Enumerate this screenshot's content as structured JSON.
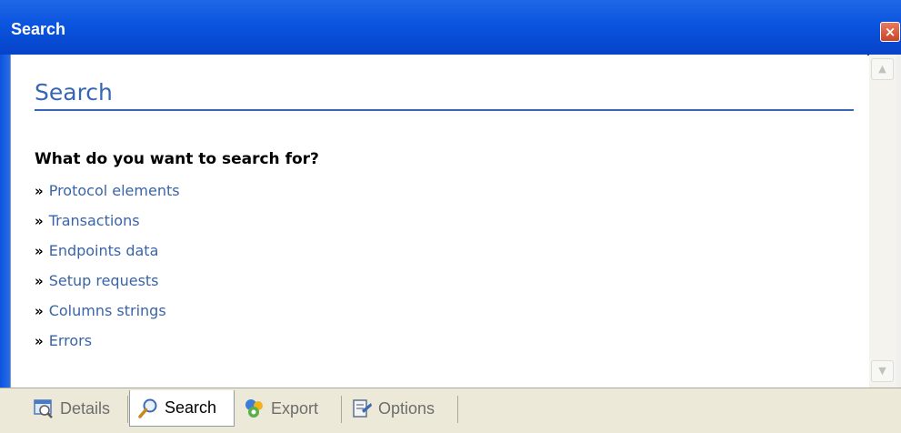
{
  "window": {
    "title": "Search",
    "close_icon": "close-icon",
    "colors": {
      "titlebar": "#0a54df",
      "heading": "#3766b3",
      "link": "#3a64a8",
      "close_button": "#c8452a",
      "tabbar": "#ece9d8"
    }
  },
  "main": {
    "heading": "Search",
    "question": "What do you want to search for?",
    "bullet": "»",
    "links": [
      "Protocol elements",
      "Transactions",
      "Endpoints data",
      "Setup requests",
      "Columns strings",
      "Errors"
    ]
  },
  "tabs": [
    {
      "label": "Details",
      "icon": "details-icon",
      "active": false
    },
    {
      "label": "Search",
      "icon": "magnifier-icon",
      "active": true
    },
    {
      "label": "Export",
      "icon": "export-icon",
      "active": false
    },
    {
      "label": "Options",
      "icon": "options-icon",
      "active": false
    }
  ]
}
